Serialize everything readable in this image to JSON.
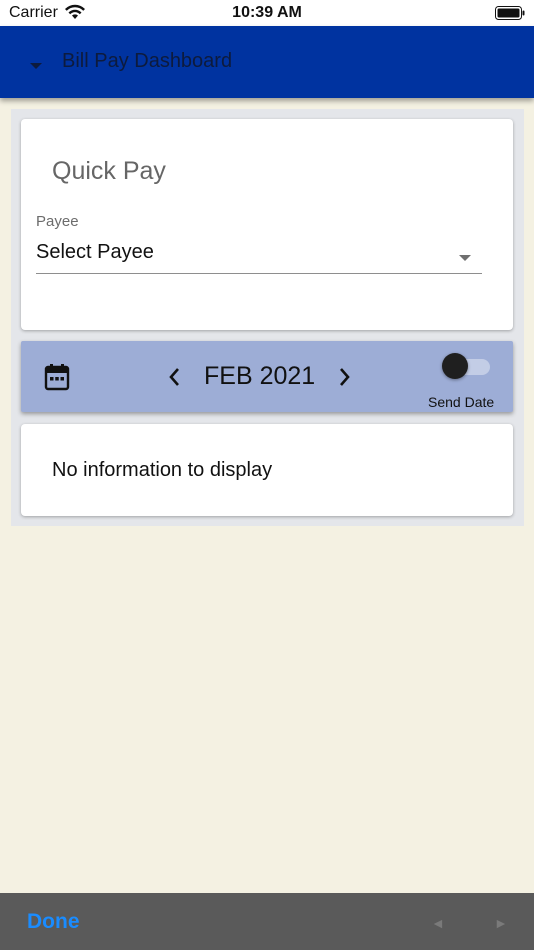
{
  "status_bar": {
    "carrier": "Carrier",
    "time": "10:39 AM",
    "wifi_icon": "wifi-icon",
    "battery_icon": "battery-icon"
  },
  "app_bar": {
    "title": "Bill Pay Dashboard",
    "menu_icon": "caret-down-icon",
    "background_color": "#0033a0"
  },
  "quick_pay": {
    "title": "Quick Pay",
    "payee_label": "Payee",
    "payee_value": "Select Payee",
    "dropdown_icon": "dropdown-arrow-icon"
  },
  "month_bar": {
    "calendar_icon": "calendar-icon",
    "prev_icon": "chevron-left-icon",
    "month": "FEB 2021",
    "next_icon": "chevron-right-icon",
    "toggle_label": "Send Date",
    "toggle_on": false,
    "background_color": "#9dadd6"
  },
  "info": {
    "message": "No information to display"
  },
  "toolbar": {
    "done_label": "Done",
    "prev_glyph": "◄",
    "next_glyph": "►",
    "accent_color": "#1a8cff"
  }
}
